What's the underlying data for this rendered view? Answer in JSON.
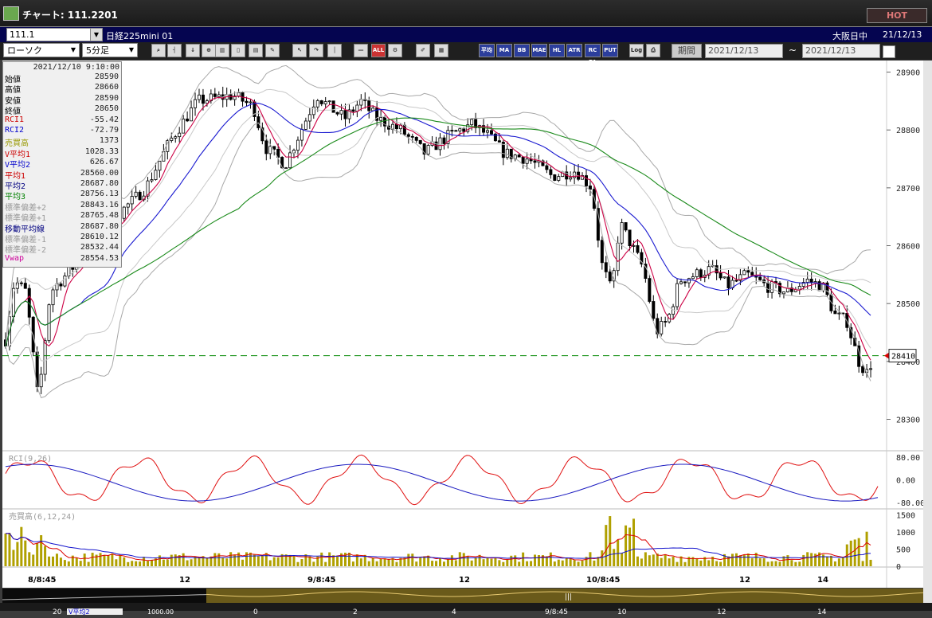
{
  "window": {
    "title": "チャート: 111.2201",
    "hot_label": "HOT"
  },
  "header": {
    "symbol_code": "111.1",
    "symbol_name": "日経225mini 01",
    "session": "大阪日中",
    "date": "21/12/13"
  },
  "toolbar": {
    "chart_type": "ローソク",
    "interval": "5分足",
    "icons": [
      "zoom-icon",
      "cursor-icon",
      "mark-icon",
      "magnify-icon",
      "bars-icon",
      "candle-icon",
      "grid-icon",
      "pen-icon",
      "arrow-icon",
      "redo-icon",
      "line-icon",
      "hline-icon",
      "all-icon",
      "settings-icon",
      "tool-icon",
      "palette-icon"
    ],
    "all_label": "ALL",
    "ind_buttons": [
      "平均",
      "MA",
      "BB",
      "MAE",
      "HL",
      "ATR",
      "RC PA",
      "PUT"
    ],
    "log_label": "Log",
    "period_label": "期間",
    "date_from": "2021/12/13",
    "tilde": "~",
    "date_to": "2021/12/13"
  },
  "info_panel": {
    "timestamp": "2021/12/10 9:10:00",
    "rows": [
      {
        "label": "始値",
        "value": "28590",
        "color": "#000000"
      },
      {
        "label": "高値",
        "value": "28660",
        "color": "#000000"
      },
      {
        "label": "安値",
        "value": "28590",
        "color": "#000000"
      },
      {
        "label": "終値",
        "value": "28650",
        "color": "#000000"
      },
      {
        "label": "RCI1",
        "value": "-55.42",
        "color": "#cc0000"
      },
      {
        "label": "RCI2",
        "value": "-72.79",
        "color": "#0000cc"
      },
      {
        "label": "売買高",
        "value": "1373",
        "color": "#999900"
      },
      {
        "label": "V平均1",
        "value": "1028.33",
        "color": "#cc0000"
      },
      {
        "label": "V平均2",
        "value": "626.67",
        "color": "#0000cc"
      },
      {
        "label": "平均1",
        "value": "28560.00",
        "color": "#cc0000"
      },
      {
        "label": "平均2",
        "value": "28687.80",
        "color": "#000080"
      },
      {
        "label": "平均3",
        "value": "28756.13",
        "color": "#008000"
      },
      {
        "label": "標準偏差+2",
        "value": "28843.16",
        "color": "#999999"
      },
      {
        "label": "標準偏差+1",
        "value": "28765.48",
        "color": "#999999"
      },
      {
        "label": "移動平均線",
        "value": "28687.80",
        "color": "#000080"
      },
      {
        "label": "標準偏差-1",
        "value": "28610.12",
        "color": "#999999"
      },
      {
        "label": "標準偏差-2",
        "value": "28532.44",
        "color": "#999999"
      },
      {
        "label": "Vwap",
        "value": "28554.53",
        "color": "#cc0099"
      }
    ]
  },
  "chart_data": {
    "type": "candlestick",
    "price_axis": {
      "ticks": [
        "28900",
        "28800",
        "28700",
        "28600",
        "28500",
        "28400",
        "28300"
      ],
      "range": [
        28247,
        28920
      ]
    },
    "current_price": "28410",
    "x_axis": {
      "labels": [
        "8/8:45",
        "12",
        "9/8:45",
        "12",
        "10/8:45",
        "12",
        "14"
      ]
    },
    "rci": {
      "label": "RCI(9,26)",
      "ticks": [
        "80.00",
        "0.00",
        "-80.00"
      ],
      "range": [
        -100,
        100
      ]
    },
    "volume": {
      "label": "売買高(6,12,24)",
      "ticks": [
        "1500",
        "1000",
        "500",
        "0"
      ],
      "range": [
        0,
        1650
      ]
    },
    "bottom_labels": [
      "20",
      "0",
      "2",
      "4",
      "9/8:45",
      "10",
      "12",
      "14"
    ],
    "colors": {
      "bb": "#a8a8a8",
      "ma_short": "#cc0044",
      "ma_mid": "#1a1ad0",
      "ma_long": "#1a8a1a",
      "vwap": "#c01080",
      "rci_fast": "#e01010",
      "rci_slow": "#1a1ac0",
      "volume": "#b0a000"
    }
  },
  "overview": {
    "partial_label": "V平均2",
    "partial_value": "1000.00"
  }
}
